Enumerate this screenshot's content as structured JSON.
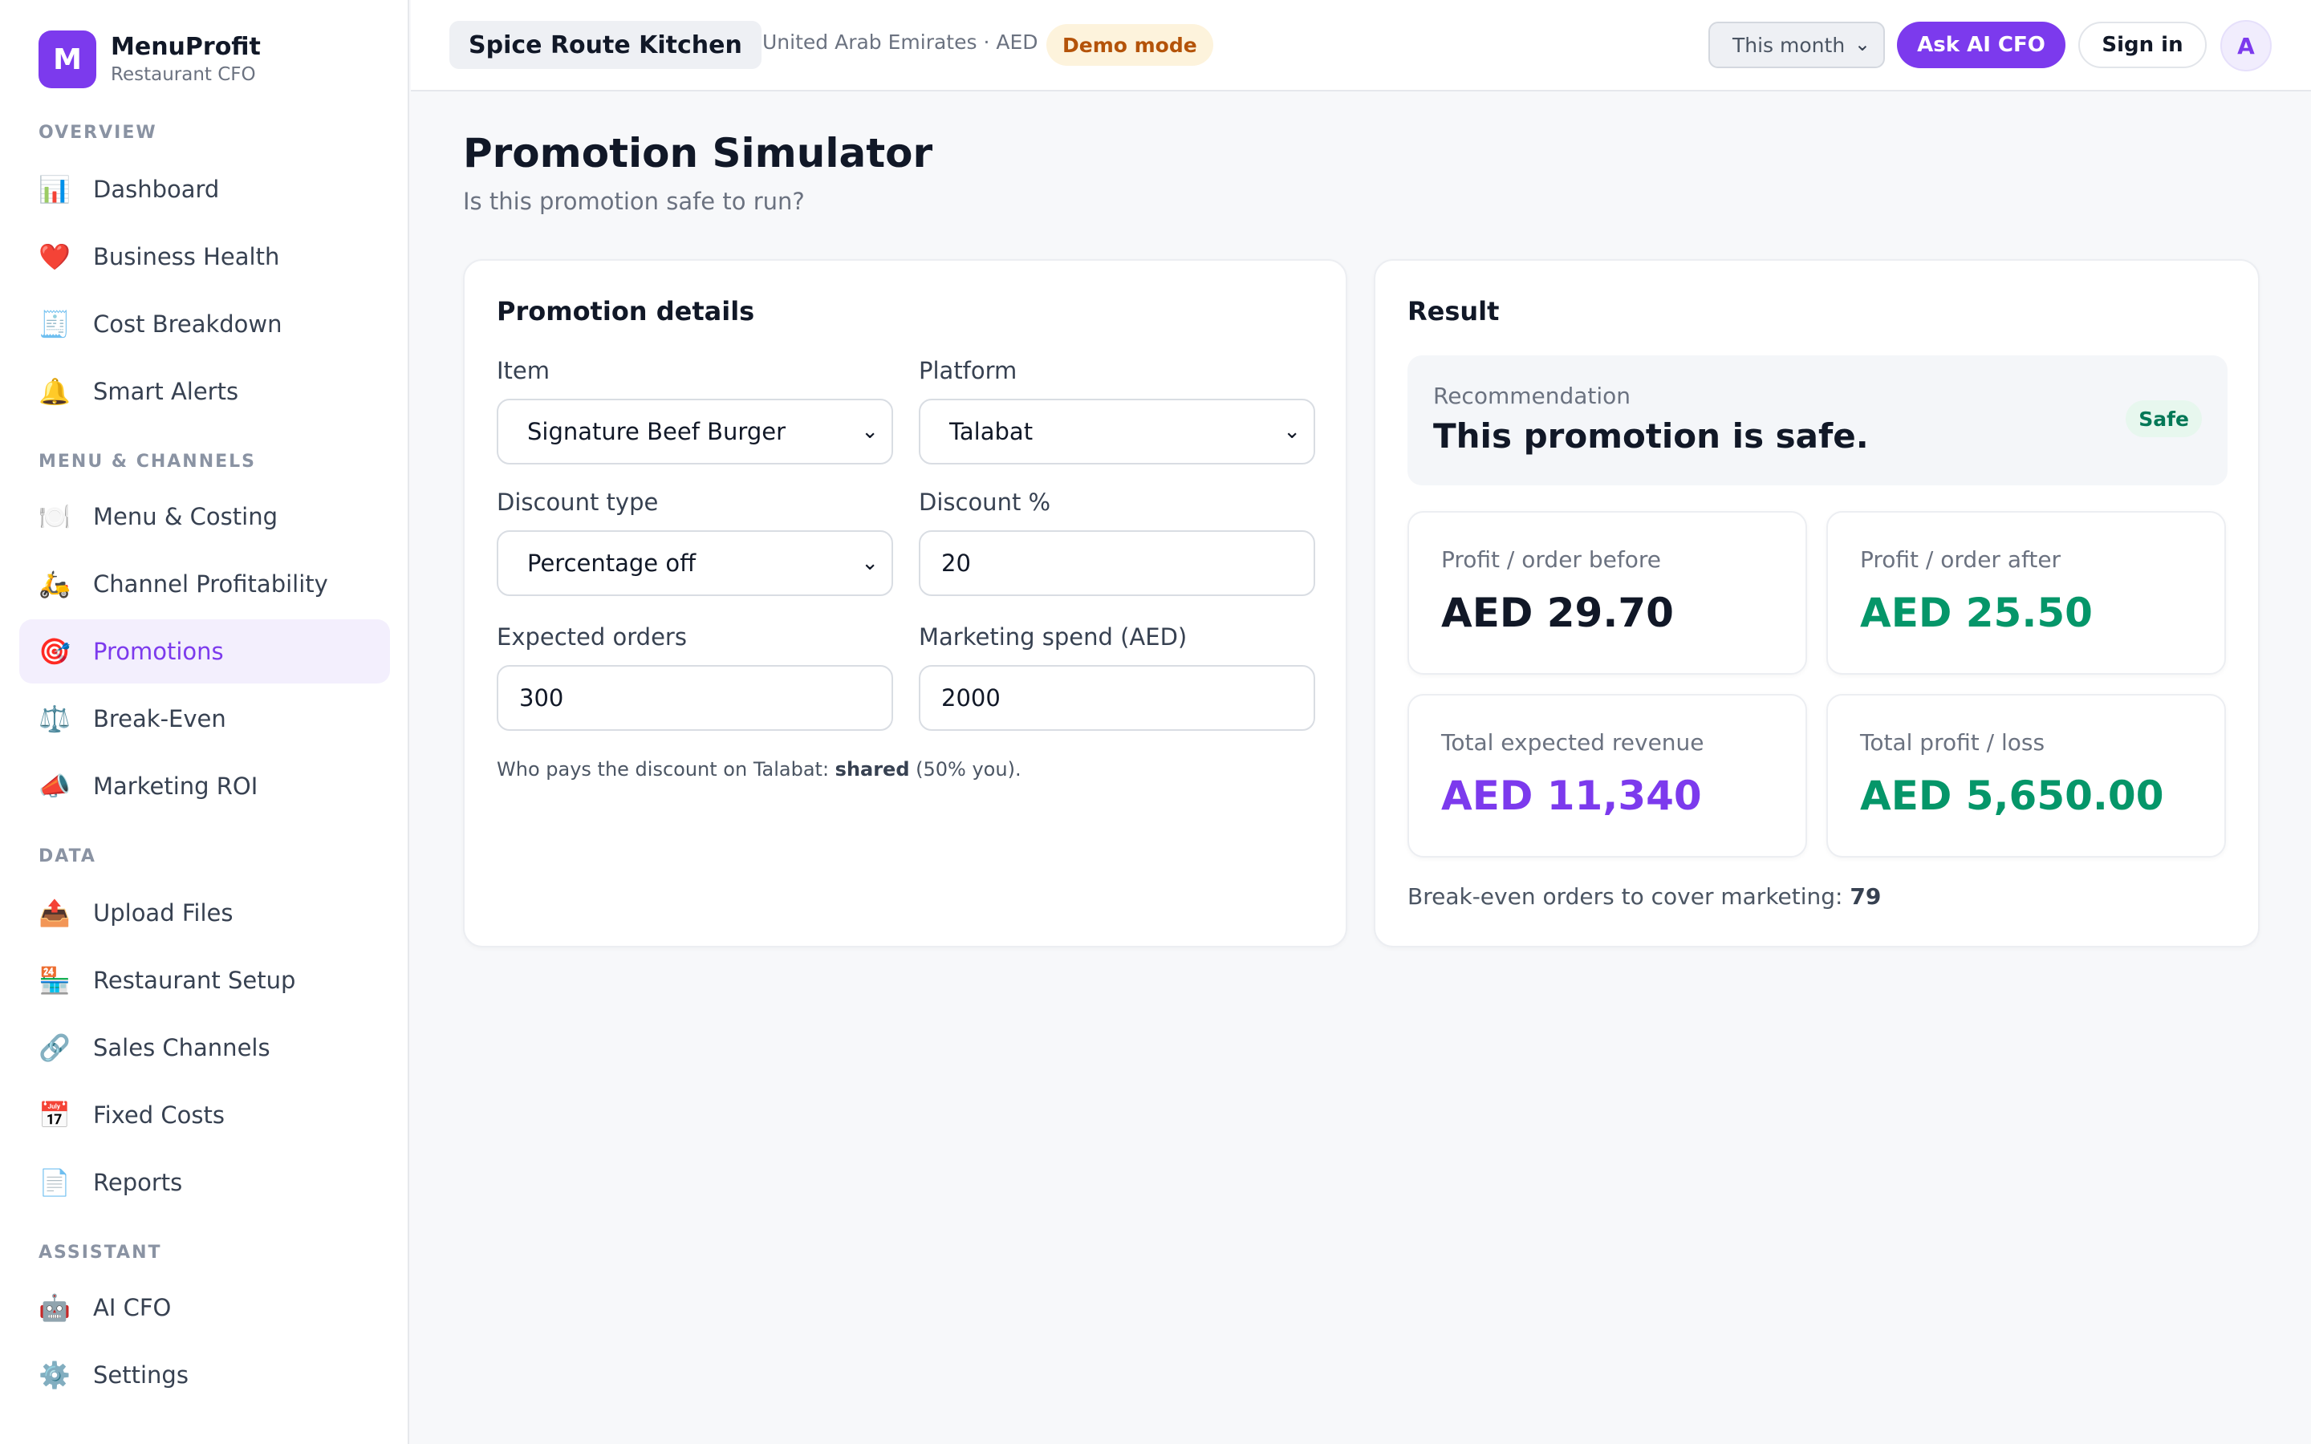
{
  "brand": {
    "initial": "M",
    "name": "MenuProfit",
    "subtitle": "Restaurant CFO"
  },
  "sidebar": {
    "sections": [
      {
        "title": "OVERVIEW"
      },
      {
        "title": "MENU & CHANNELS"
      },
      {
        "title": "DATA"
      },
      {
        "title": "ASSISTANT"
      }
    ],
    "items": [
      {
        "icon": "📊",
        "icon_name": "bar-chart-icon",
        "label": "Dashboard"
      },
      {
        "icon": "❤️",
        "icon_name": "heart-icon",
        "label": "Business Health"
      },
      {
        "icon": "🧾",
        "icon_name": "receipt-icon",
        "label": "Cost Breakdown"
      },
      {
        "icon": "🔔",
        "icon_name": "bell-icon",
        "label": "Smart Alerts"
      },
      {
        "icon": "🍽️",
        "icon_name": "plate-icon",
        "label": "Menu & Costing"
      },
      {
        "icon": "🛵",
        "icon_name": "scooter-icon",
        "label": "Channel Profitability"
      },
      {
        "icon": "🎯",
        "icon_name": "target-icon",
        "label": "Promotions",
        "active": true
      },
      {
        "icon": "⚖️",
        "icon_name": "scale-icon",
        "label": "Break-Even"
      },
      {
        "icon": "📣",
        "icon_name": "megaphone-icon",
        "label": "Marketing ROI"
      },
      {
        "icon": "📤",
        "icon_name": "upload-icon",
        "label": "Upload Files"
      },
      {
        "icon": "🏪",
        "icon_name": "store-icon",
        "label": "Restaurant Setup"
      },
      {
        "icon": "🔗",
        "icon_name": "link-icon",
        "label": "Sales Channels"
      },
      {
        "icon": "📅",
        "icon_name": "calendar-icon",
        "label": "Fixed Costs"
      },
      {
        "icon": "📄",
        "icon_name": "document-icon",
        "label": "Reports"
      },
      {
        "icon": "🤖",
        "icon_name": "robot-icon",
        "label": "AI CFO"
      },
      {
        "icon": "⚙️",
        "icon_name": "gear-icon",
        "label": "Settings"
      }
    ]
  },
  "topbar": {
    "restaurant_name": "Spice Route Kitchen",
    "meta": "United Arab Emirates · AED",
    "demo_badge": "Demo mode",
    "period": "This month",
    "ask_label": "Ask AI CFO",
    "signin_label": "Sign in",
    "avatar_initial": "A"
  },
  "page": {
    "title": "Promotion Simulator",
    "subtitle": "Is this promotion safe to run?"
  },
  "details": {
    "title": "Promotion details",
    "item_label": "Item",
    "item_value": "Signature Beef Burger",
    "platform_label": "Platform",
    "platform_value": "Talabat",
    "discount_type_label": "Discount type",
    "discount_type_value": "Percentage off",
    "discount_pct_label": "Discount %",
    "discount_pct_value": "20",
    "orders_label": "Expected orders",
    "orders_value": "300",
    "marketing_label": "Marketing spend (AED)",
    "marketing_value": "2000",
    "payer_prefix": "Who pays the discount on Talabat: ",
    "payer_strong": "shared",
    "payer_suffix": " (50% you)."
  },
  "result": {
    "title": "Result",
    "recommendation_label": "Recommendation",
    "recommendation_text": "This promotion is safe.",
    "badge": "Safe",
    "metrics": [
      {
        "label": "Profit / order before",
        "value": "AED 29.70",
        "color": "#111827"
      },
      {
        "label": "Profit / order after",
        "value": "AED 25.50",
        "color": "#059669"
      },
      {
        "label": "Total expected revenue",
        "value": "AED 11,340",
        "color": "#7c3aed"
      },
      {
        "label": "Total profit / loss",
        "value": "AED 5,650.00",
        "color": "#059669"
      }
    ],
    "breakeven_prefix": "Break-even orders to cover marketing: ",
    "breakeven_value": "79"
  },
  "colors": {
    "accent": "#7c3aed",
    "positive": "#059669",
    "warning": "#b45309"
  }
}
